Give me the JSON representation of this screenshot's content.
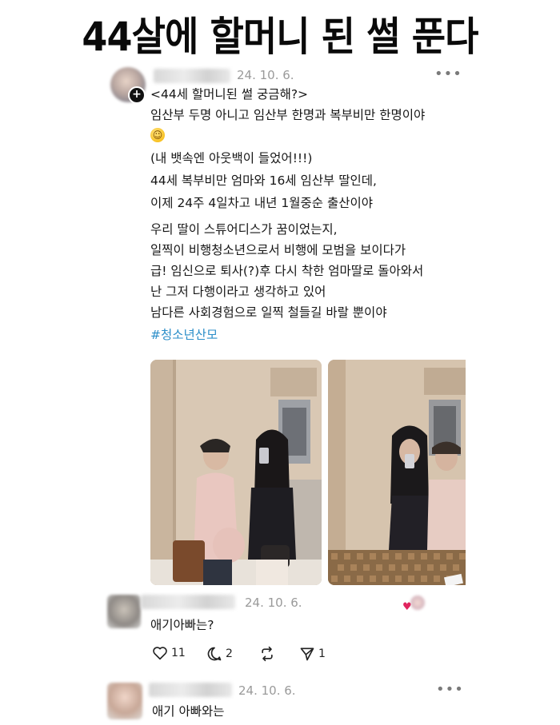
{
  "headline": "44살에 할머니 된 썰 푼다",
  "post": {
    "date": "24. 10. 6.",
    "more": "•••",
    "lines": [
      "<44세 할머니된 썰 궁금해?>",
      "임산부 두명 아니고 임산부 한명과 복부비만 한명이야",
      "",
      "(내 뱃속엔 아웃백이 들었어!!!)",
      "44세 복부비만 엄마와 16세 임산부 딸인데,",
      "이제 24주 4일차고 내년 1월중순 출산이야",
      "우리 딸이 스튜어디스가 꿈이었는지,",
      "일찍이 비행청소년으로서 비행에 모범을 보이다가",
      "급! 임신으로 퇴사(?)후 다시 착한 엄마딸로 돌아와서",
      "난 그저 다행이라고 생각하고 있어",
      "남다른 사회경험으로 일찍 철들길 바랄 뿐이야"
    ],
    "hashtag": "#청소년산모"
  },
  "comment1": {
    "date": "24. 10. 6.",
    "text": "애기아빠는?",
    "like_count": "11",
    "reply_count": "2",
    "share_count": "1"
  },
  "comment2": {
    "date": "24. 10. 6.",
    "more": "•••",
    "text": "애기 아빠와는"
  },
  "icons": [
    "plus-icon",
    "more-icon",
    "heart-icon",
    "comment-icon",
    "repost-icon",
    "send-icon"
  ],
  "colors": {
    "hashtag": "#2d8fc9",
    "heart": "#e0245e"
  }
}
